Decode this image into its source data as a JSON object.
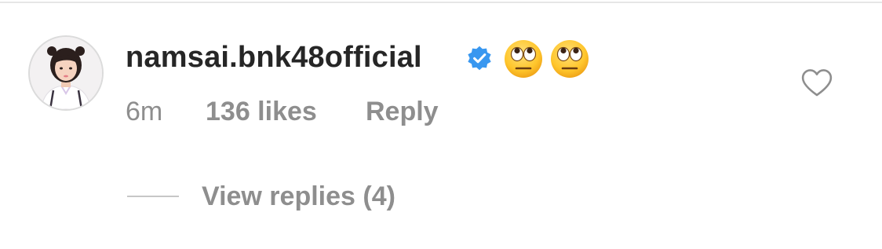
{
  "comment": {
    "avatar_icon": "profile-photo-avatar",
    "username": "namsai.bnk48official",
    "verified_icon": "verified-badge-icon",
    "verified_color": "#3897f0",
    "emojis": [
      "🙄",
      "🙄"
    ],
    "emoji_name": "face-with-rolling-eyes",
    "time": "6m",
    "likes": "136 likes",
    "reply_label": "Reply",
    "like_icon": "heart-outline-icon",
    "view_replies_label": "View replies (4)"
  },
  "colors": {
    "text_primary": "#262626",
    "text_secondary": "#8e8e8e",
    "divider": "#dbdbdb"
  }
}
